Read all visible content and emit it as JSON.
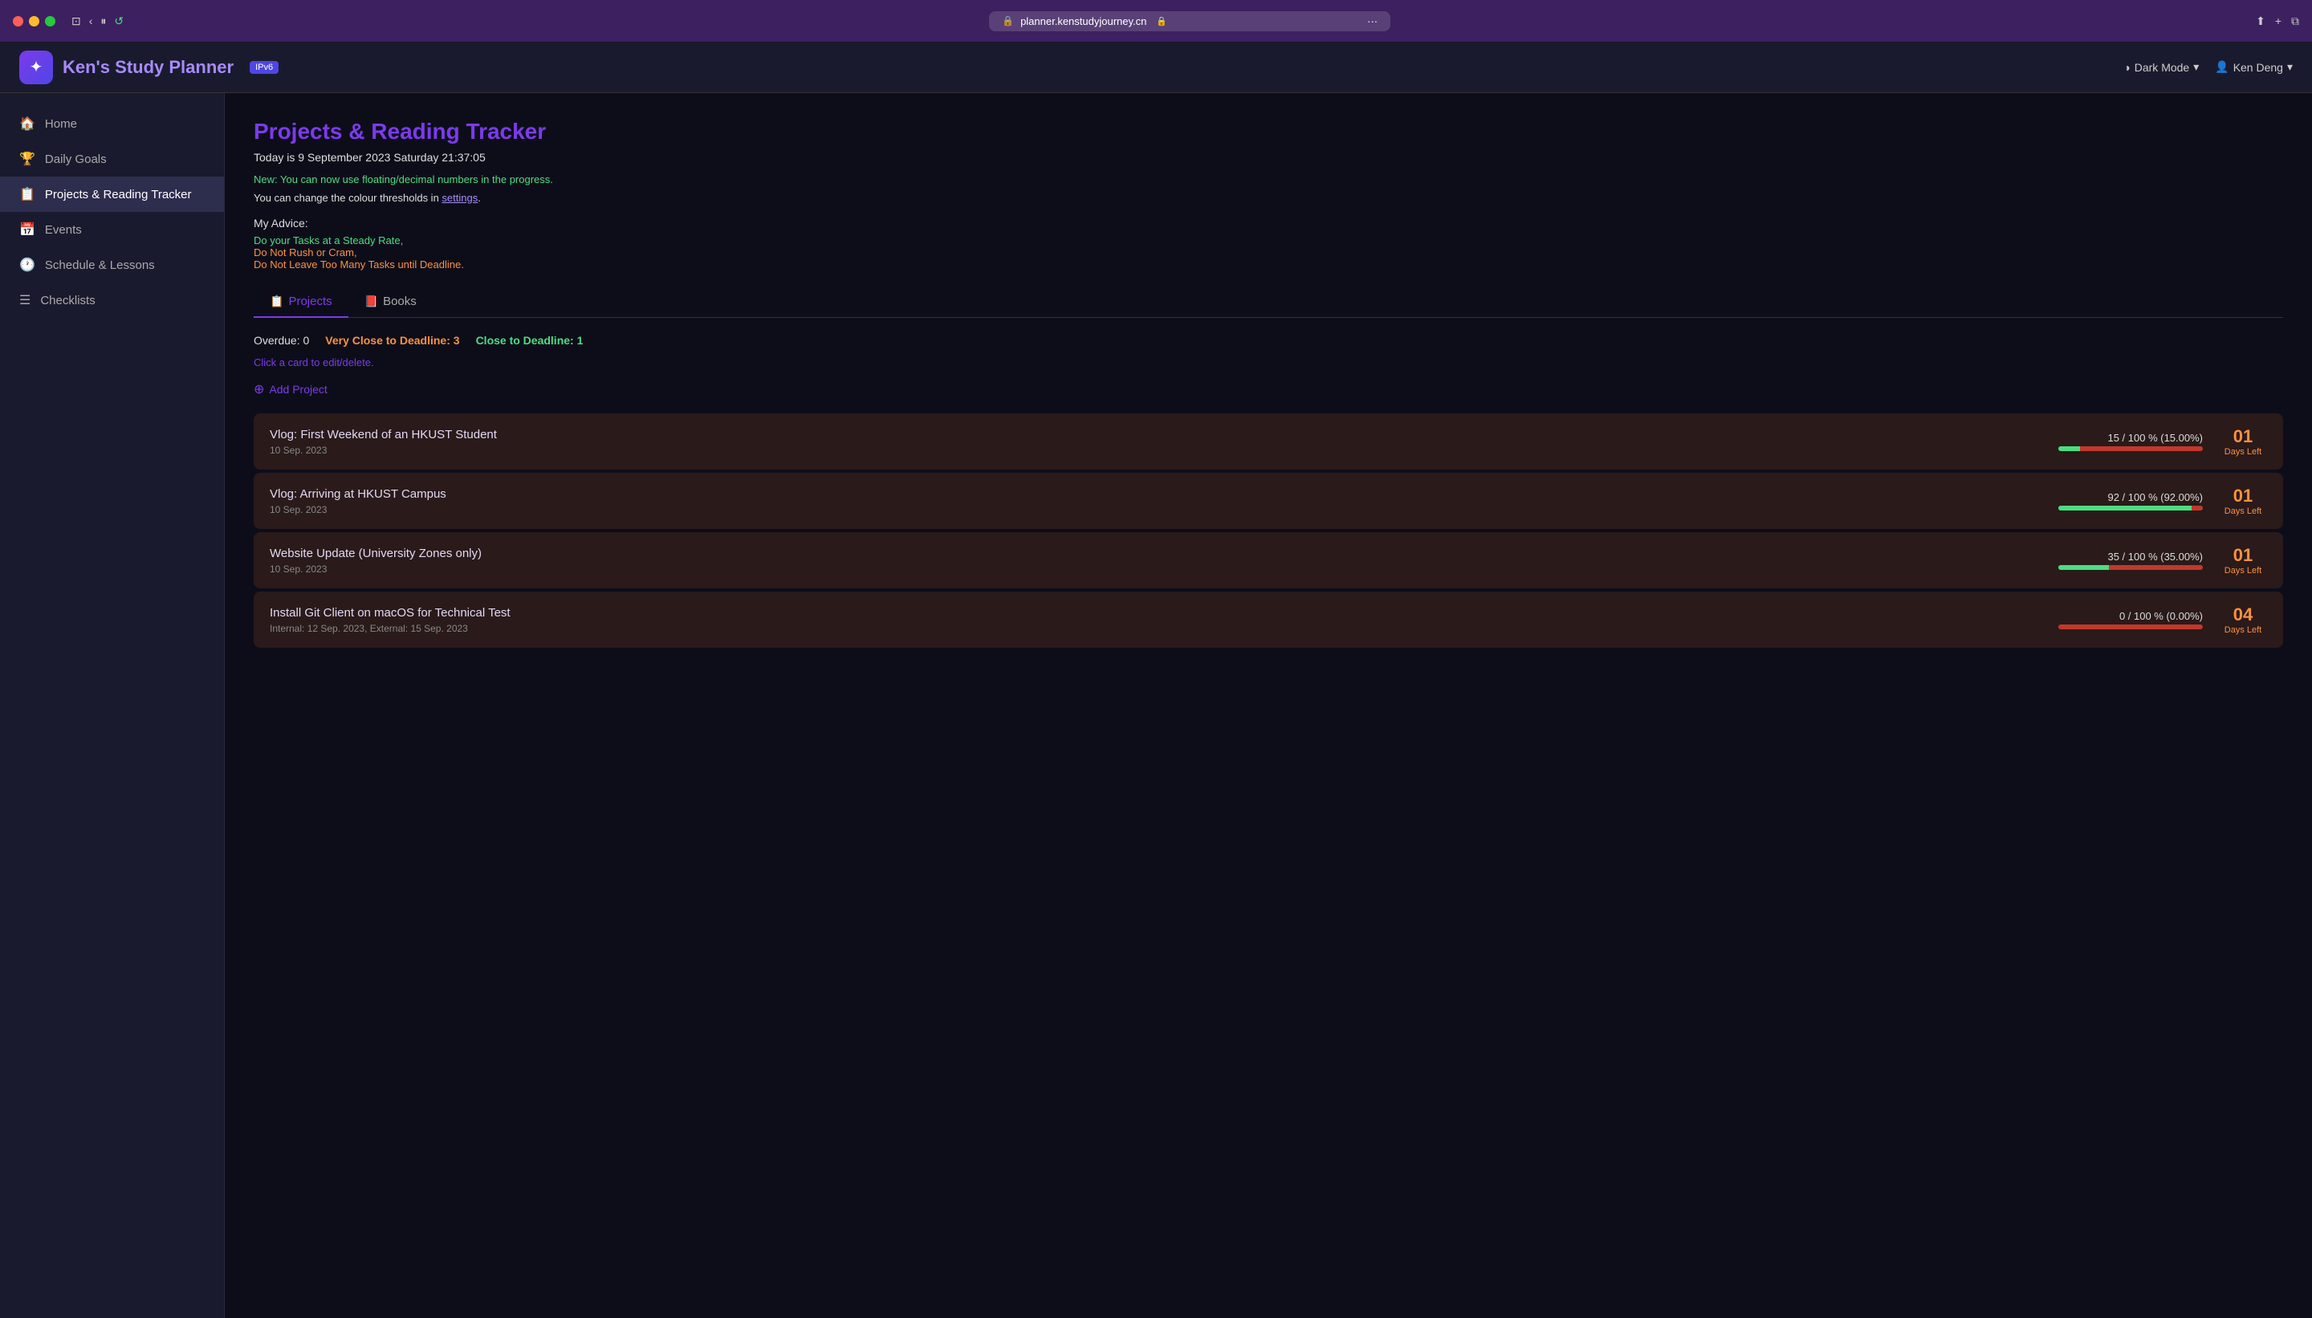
{
  "browser": {
    "url": "planner.kenstudyjourney.cn",
    "lock_icon": "🔒",
    "dots_icon": "···"
  },
  "header": {
    "logo_text": "✦",
    "title": "Ken's Study Planner",
    "ipv6_label": "IPv6",
    "dark_mode_label": "Dark Mode",
    "user_label": "Ken Deng"
  },
  "sidebar": {
    "items": [
      {
        "id": "home",
        "icon": "🏠",
        "label": "Home"
      },
      {
        "id": "daily-goals",
        "icon": "🏆",
        "label": "Daily Goals"
      },
      {
        "id": "projects",
        "icon": "📋",
        "label": "Projects & Reading Tracker"
      },
      {
        "id": "events",
        "icon": "📅",
        "label": "Events"
      },
      {
        "id": "schedule",
        "icon": "🕐",
        "label": "Schedule & Lessons"
      },
      {
        "id": "checklists",
        "icon": "☰",
        "label": "Checklists"
      }
    ]
  },
  "main": {
    "page_title": "Projects & Reading Tracker",
    "date_time": "Today is 9 September 2023  Saturday  21:37:05",
    "notice_new": "New: You can now use floating/decimal numbers in the progress.",
    "notice_settings": "You can change the colour thresholds in settings.",
    "settings_link_text": "settings",
    "advice_title": "My Advice:",
    "advice_lines": [
      {
        "text": "Do your Tasks at a Steady Rate,",
        "color": "green"
      },
      {
        "text": "Do Not Rush or Cram,",
        "color": "orange"
      },
      {
        "text": "Do Not Leave Too Many Tasks until Deadline.",
        "color": "orange"
      }
    ],
    "tabs": [
      {
        "id": "projects",
        "icon": "📋",
        "label": "Projects",
        "active": true
      },
      {
        "id": "books",
        "icon": "📕",
        "label": "Books",
        "active": false
      }
    ],
    "stats": {
      "overdue_label": "Overdue: 0",
      "very_close_label": "Very Close to Deadline: 3",
      "close_label": "Close to Deadline: 1"
    },
    "click_hint": "Click a card to edit/delete.",
    "add_project_label": "Add Project",
    "projects": [
      {
        "title": "Vlog: First Weekend of an HKUST Student",
        "date": "10 Sep. 2023",
        "progress_text": "15 / 100 % (15.00%)",
        "progress_pct": 15,
        "days_num": "01",
        "days_label": "Days Left",
        "bar_color": "green"
      },
      {
        "title": "Vlog: Arriving at HKUST Campus",
        "date": "10 Sep. 2023",
        "progress_text": "92 / 100 % (92.00%)",
        "progress_pct": 92,
        "days_num": "01",
        "days_label": "Days Left",
        "bar_color": "green"
      },
      {
        "title": "Website Update (University Zones only)",
        "date": "10 Sep. 2023",
        "progress_text": "35 / 100 % (35.00%)",
        "progress_pct": 35,
        "days_num": "01",
        "days_label": "Days Left",
        "bar_color": "green"
      },
      {
        "title": "Install Git Client on macOS for Technical Test",
        "date": "Internal: 12 Sep. 2023, External: 15 Sep. 2023",
        "progress_text": "0 / 100 % (0.00%)",
        "progress_pct": 0,
        "days_num": "04",
        "days_label": "Days Left",
        "bar_color": "orange"
      }
    ]
  }
}
